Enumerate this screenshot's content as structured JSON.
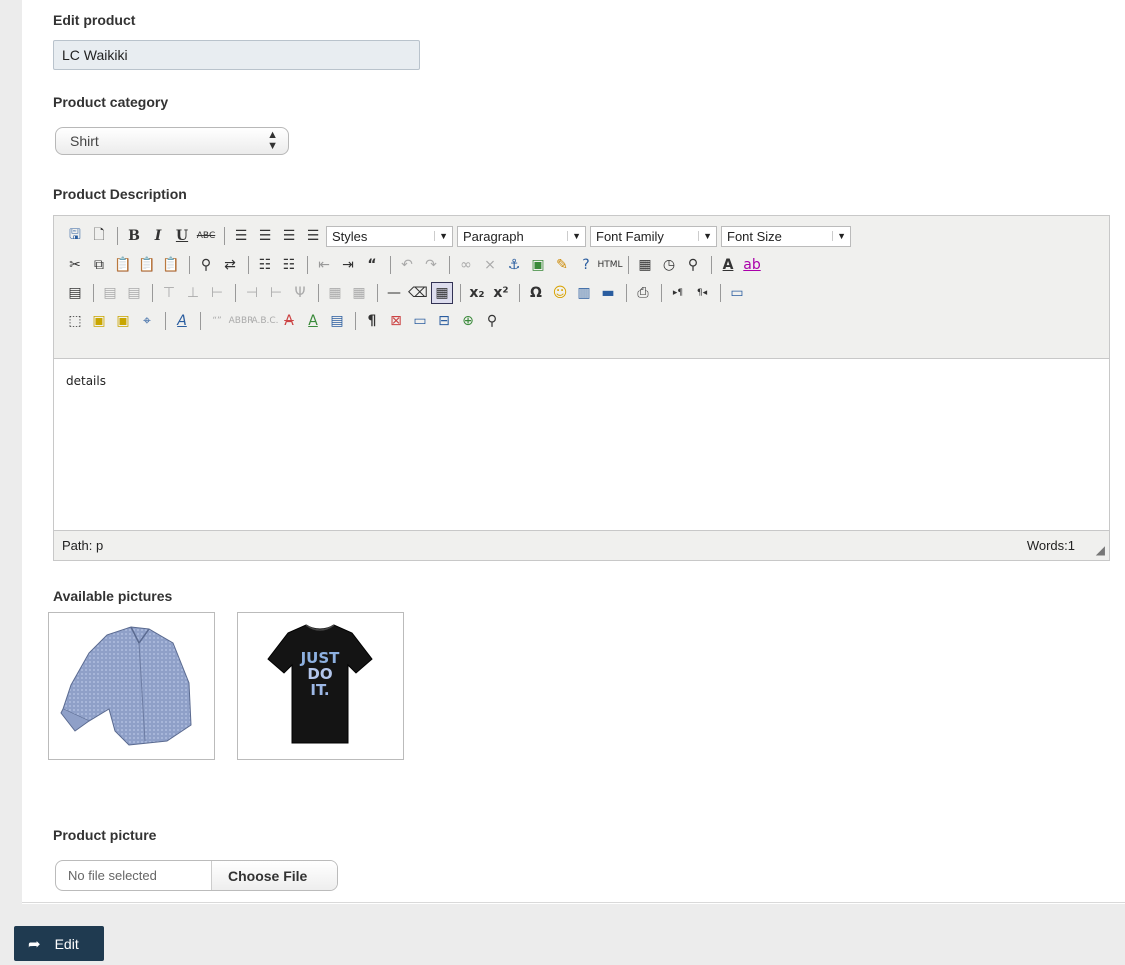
{
  "form": {
    "edit_product_label": "Edit product",
    "product_name_value": "LC Waikiki",
    "category_label": "Product category",
    "category_selected": "Shirt",
    "description_label": "Product Description",
    "pictures_label": "Available pictures",
    "product_picture_label": "Product picture",
    "file_status": "No file selected",
    "choose_file_label": "Choose File",
    "submit_label": "Edit"
  },
  "editor": {
    "dropdowns": {
      "styles": "Styles",
      "paragraph": "Paragraph",
      "font_family": "Font Family",
      "font_size": "Font Size"
    },
    "content": "details",
    "path": "Path: p",
    "words": "Words:1",
    "tshirt_text": [
      "JUST",
      "DO",
      "IT."
    ]
  },
  "colors": {
    "submit_bg": "#1f3a50",
    "name_input_bg": "#e8edf1"
  },
  "icons": {
    "row1": [
      "save-icon",
      "new-document-icon",
      "sep",
      "bold-icon",
      "italic-icon",
      "underline-icon",
      "strikethrough-icon",
      "sep",
      "align-left-icon",
      "align-center-icon",
      "align-right-icon",
      "align-justify-icon"
    ],
    "row2": [
      "cut-icon",
      "copy-icon",
      "paste-icon",
      "paste-text-icon",
      "paste-word-icon",
      "sep",
      "find-icon",
      "replace-icon",
      "sep",
      "bullet-list-icon",
      "numbered-list-icon",
      "sep",
      "outdent-icon",
      "indent-icon",
      "blockquote-icon",
      "sep",
      "undo-icon",
      "redo-icon",
      "sep",
      "link-icon",
      "unlink-icon",
      "anchor-icon",
      "image-icon",
      "cleanup-icon",
      "help-icon",
      "html-icon",
      "sep",
      "insert-date-icon",
      "insert-time-icon",
      "preview-icon",
      "sep",
      "text-color-icon",
      "highlight-color-icon"
    ],
    "row3": [
      "table-props-icon",
      "sep",
      "row-props-icon",
      "cell-props-icon",
      "sep",
      "row-before-icon",
      "row-after-icon",
      "delete-row-icon",
      "sep",
      "col-before-icon",
      "col-after-icon",
      "delete-col-icon",
      "sep",
      "split-cells-icon",
      "merge-cells-icon",
      "sep",
      "horizontal-rule-icon",
      "remove-format-icon",
      "visual-aid-icon",
      "sep",
      "subscript-icon",
      "superscript-icon",
      "sep",
      "special-char-icon",
      "emoticon-icon",
      "media-icon",
      "advanced-hr-icon",
      "sep",
      "print-icon",
      "sep",
      "ltr-icon",
      "rtl-icon",
      "sep",
      "fullscreen-icon"
    ],
    "row4": [
      "insert-layer-icon",
      "move-forward-icon",
      "move-backward-icon",
      "absolute-position-icon",
      "sep",
      "styleprops-icon",
      "sep",
      "cite-icon",
      "abbreviation-icon",
      "acronym-icon",
      "deletion-icon",
      "insertion-icon",
      "attributes-icon",
      "sep",
      "show-blocks-icon",
      "page-break-icon",
      "template-icon",
      "nonbreaking-icon",
      "spellcheck-icon",
      "preview-find-icon"
    ]
  }
}
